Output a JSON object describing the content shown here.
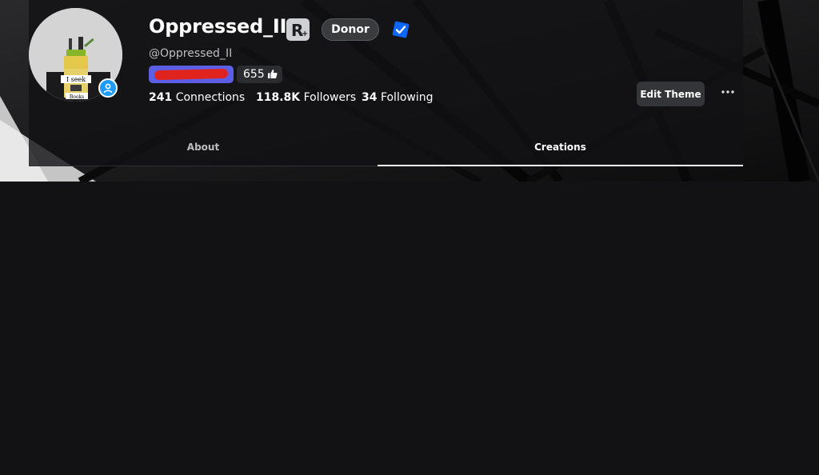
{
  "profile": {
    "display_name": "Oppressed_II",
    "username": "@Oppressed_II",
    "donor_badge": "Donor",
    "likes": "655",
    "premium_icon": "premium-r-icon",
    "verified_icon": "verified-check-icon",
    "presence_icon": "online-user-icon"
  },
  "stats": {
    "connections_value": "241",
    "connections_label": "Connections",
    "followers_value": "118.8K",
    "followers_label": "Followers",
    "following_value": "34",
    "following_label": "Following"
  },
  "actions": {
    "edit_theme": "Edit Theme"
  },
  "tabs": [
    {
      "label": "About",
      "active": false
    },
    {
      "label": "Creations",
      "active": true
    }
  ],
  "colors": {
    "page_bg": "#121214",
    "verified": "#0a66ff",
    "group_badge": "#5c5fe6",
    "presence": "#1f9bff"
  }
}
